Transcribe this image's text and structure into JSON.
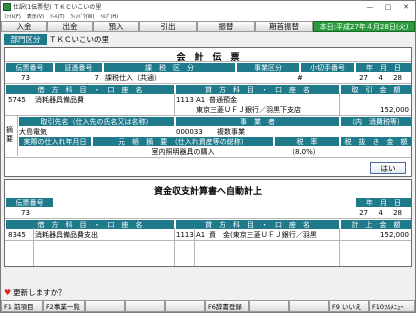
{
  "window": {
    "title": "仕訳(1伝票型) ＴＫＣいこいの里",
    "minimize": "—",
    "maximize": "□",
    "close": "✕"
  },
  "menu": [
    "ﾌｧｲﾙ(F)",
    "表示(V)",
    "ﾂｰﾙ(T)",
    "ｳｨﾝﾄﾞｳ(W)",
    "ﾍﾙﾌﾟ(H)"
  ],
  "toolbar": {
    "nyuukin": "入金",
    "shukkin": "出金",
    "yonyuu": "預入",
    "hikidashi": "引出",
    "furikae": "振替",
    "kishu": "期首振替",
    "date": "本日:平成27年４月28日(火)"
  },
  "section": {
    "label": "部門区分",
    "value": "ＴＫＣいこいの里"
  },
  "voucher": {
    "title": "会　計　伝　票",
    "headers": {
      "denpyo_no": "伝票番号",
      "shoushou_no": "証憑番号",
      "kazei": "課　税　区　分",
      "jigyou": "事業区分",
      "kogitte": "小切手番号",
      "nengappi": "年　月　日"
    },
    "values": {
      "denpyo_no": "73",
      "shoushou_no": "7",
      "kazei": "課税仕入（共通）",
      "jigyou": "#",
      "year": "27",
      "month": "4",
      "day": "28"
    },
    "row2_headers": {
      "debit": "借　方　科　目　・　口　座　名",
      "credit": "貸　方　科　目　・　口　座　名",
      "amount": "取　引　金　額"
    },
    "debit": {
      "code": "5745",
      "name": "消耗器具備品費"
    },
    "credit": {
      "code1": "1113",
      "code2": "A1",
      "name1": "普通預金",
      "name2": "東京三菱ＵＦＪ銀行／羽黒下支店"
    },
    "amount": "152,000",
    "side_label": "摘要",
    "row3_headers": {
      "torihiki": "取引先名（仕入先の氏名又は名称）",
      "jigyousha": "事　業　者",
      "shouhizei": "（内　消費税等）"
    },
    "torihiki_value": "大島電気",
    "jigyousha_code": "000033",
    "jigyousha_name": "複数事業",
    "row4_headers": {
      "jissai": "実際の仕入れ年月日",
      "gentan": "元　帳　摘　要　（仕入れ資産等の総称）",
      "zeiritsu": "税　率",
      "zeinuki": "税　抜　き　金　額"
    },
    "gentan_value": "室内照明器具の購入",
    "zeiritsu_value": "（8.0%）",
    "ok": "はい"
  },
  "summary": {
    "title": "資金収支計算書へ自動計上",
    "headers": {
      "denpyo_no": "伝票番号",
      "nengappi": "年　月　日"
    },
    "values": {
      "denpyo_no": "73",
      "year": "27",
      "month": "4",
      "day": "28"
    },
    "row_headers": {
      "debit": "借　方　科　目　・　口　座　名",
      "credit": "貸　方　科　目　・　口　座　名",
      "amount": "計　上　金　額"
    },
    "debit": {
      "code": "8345",
      "name": "消耗器具備品費支出"
    },
    "credit": {
      "code1": "1113",
      "code2": "A1",
      "name": "資　金(東京三菱ＵＦＪ銀行／羽黒"
    },
    "amount": "152,000"
  },
  "prompt": {
    "icon": "♥",
    "text": "更新しますか？"
  },
  "fkeys": [
    "F1 前項目",
    "F2事業一覧",
    "",
    "",
    "",
    "F6辞書登録",
    "",
    "",
    "F9 いいえ",
    "F10ﾌﾙﾒﾆｭｰ"
  ]
}
